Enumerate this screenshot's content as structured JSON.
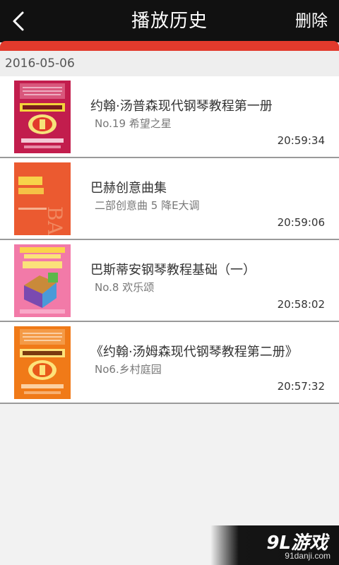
{
  "header": {
    "title": "播放历史",
    "delete_label": "删除"
  },
  "date_group": "2016-05-06",
  "items": [
    {
      "title": "约翰·汤普森现代钢琴教程第一册",
      "subtitle": "No.19 希望之星",
      "time": "20:59:34",
      "cover_color": "#c21d4d"
    },
    {
      "title": "巴赫创意曲集",
      "subtitle": "二部创意曲 5 降E大调",
      "time": "20:59:06",
      "cover_color": "#e8522c"
    },
    {
      "title": "巴斯蒂安钢琴教程基础（一）",
      "subtitle": "No.8 欢乐颂",
      "time": "20:58:02",
      "cover_color": "#f27aa8"
    },
    {
      "title": "《约翰·汤姆森现代钢琴教程第二册》",
      "subtitle": "No6.乡村庭园",
      "time": "20:57:32",
      "cover_color": "#f07a18"
    }
  ],
  "watermark": {
    "logo": "9L游戏",
    "url": "91danji.com"
  }
}
